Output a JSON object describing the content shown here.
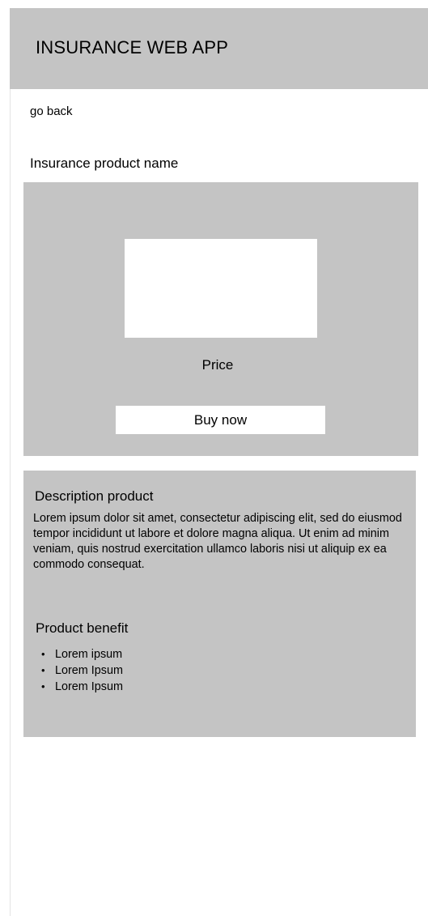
{
  "header": {
    "title": "INSURANCE WEB APP"
  },
  "nav": {
    "go_back_label": "go back"
  },
  "product": {
    "name": "Insurance product name",
    "price_label": "Price",
    "buy_label": "Buy now"
  },
  "description": {
    "title": "Description product",
    "body": "Lorem ipsum dolor sit amet, consectetur adipiscing elit, sed do eiusmod tempor incididunt ut labore et dolore magna aliqua. Ut enim ad minim veniam, quis nostrud exercitation ullamco laboris nisi ut aliquip ex ea commodo consequat."
  },
  "benefits": {
    "title": "Product benefit",
    "items": [
      "Lorem ipsum",
      "Lorem Ipsum",
      "Lorem Ipsum"
    ]
  },
  "colors": {
    "panel_gray": "#c4c4c4",
    "background": "#ffffff",
    "text": "#000000"
  }
}
